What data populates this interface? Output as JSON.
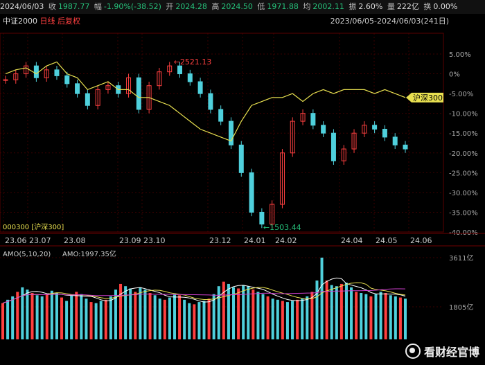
{
  "header": {
    "date": "2024/06/03",
    "close_label": "收",
    "close": "1987.77",
    "chg_label": "幅",
    "chg": "-1.90%(-38.52)",
    "open_label": "开",
    "open": "2024.28",
    "high_label": "高",
    "high": "2024.50",
    "low_label": "低",
    "low": "1971.88",
    "avg_label": "均",
    "avg": "2002.11",
    "amp_label": "振",
    "amp": "2.60%",
    "amount_label": "量",
    "amount": "222亿",
    "turnover_label": "换",
    "turnover": "0.00%"
  },
  "subheader": {
    "index_name": "中证2000",
    "period": "日线",
    "adjust": "后复权",
    "range": "2023/06/05-2024/06/03(241日)"
  },
  "chart_data": [
    {
      "type": "line",
      "title": "中证2000",
      "x": [
        "23.06",
        "23.07",
        "23.08",
        "23.09",
        "23.10",
        "23.12",
        "24.01",
        "24.02",
        "24.04",
        "24.05",
        "24.06"
      ],
      "ylim": [
        -40,
        5
      ],
      "y_ticks": [
        "5.00%",
        "0%",
        "-5.00%",
        "-10.00%",
        "-15.00%",
        "-20.00%",
        "-25.00%",
        "-30.00%",
        "-35.00%",
        "-40.00%"
      ],
      "series": [
        {
          "name": "中证2000",
          "style": "candles",
          "values": [
            -1.5,
            0,
            2,
            -1,
            1,
            -0.5,
            -2.5,
            -5,
            -8,
            -4,
            -3,
            -5,
            -1,
            -9,
            -3,
            0.5,
            2,
            0,
            -2,
            -5,
            -9,
            -12,
            -18,
            -25,
            -35,
            -38,
            -33,
            -20,
            -12,
            -10,
            -13,
            -15,
            -22,
            -19,
            -15,
            -13,
            -14,
            -16,
            -18,
            -19
          ],
          "color_up": "#ff4040",
          "color_down": "#4fd0dc"
        },
        {
          "name": "沪深300",
          "values": [
            0,
            1,
            1.5,
            0,
            2,
            3,
            0,
            -1,
            -4,
            -3,
            -2,
            -4,
            -4,
            -6,
            -6,
            -7,
            -8,
            -10,
            -12,
            -14,
            -15,
            -16,
            -17,
            -12,
            -8,
            -7,
            -6,
            -6,
            -5,
            -7,
            -5,
            -4,
            -5,
            -4,
            -4,
            -4,
            -5,
            -4,
            -5,
            -6
          ],
          "color": "#e8e050"
        }
      ],
      "annotations": [
        {
          "text": "2521.13",
          "color": "#ff4040"
        },
        {
          "text": "1503.44",
          "color": "#26c07a"
        },
        {
          "text": "沪深300",
          "color": "#e8e050"
        }
      ],
      "legend": "000300 [沪深300]",
      "colors": {
        "up": "#ff4040",
        "down": "#4fd0dc",
        "compare": "#e8e050",
        "grid": "#3a0000"
      }
    },
    {
      "type": "bar",
      "title": "AMO(5,10,20)",
      "value_label": "AMO:1997.35亿",
      "y_ticks": [
        "3611亿",
        "1805亿"
      ],
      "ylim": [
        0,
        3611
      ],
      "values": [
        1600,
        1750,
        1900,
        2100,
        2300,
        2200,
        2050,
        1950,
        1900,
        2000,
        2150,
        2050,
        1850,
        1700,
        1950,
        2100,
        2000,
        1800,
        1650,
        1600,
        1700,
        1750,
        1900,
        2200,
        2450,
        2350,
        2250,
        2100,
        2300,
        2200,
        2050,
        1950,
        1800,
        1750,
        1850,
        2000,
        1950,
        1750,
        1600,
        1550,
        1650,
        1700,
        1800,
        2000,
        2350,
        2550,
        2450,
        2300,
        2250,
        2400,
        2350,
        2200,
        2100,
        2000,
        1900,
        1800,
        1750,
        1700,
        1650,
        1700,
        1750,
        1800,
        1900,
        2100,
        2600,
        3611,
        2600,
        2400,
        2350,
        2450,
        2500,
        2300,
        2100,
        2050,
        2000,
        1900,
        2000,
        2100,
        2050,
        1950,
        1900,
        1850,
        1800
      ],
      "ma_colors": [
        "#ffffff",
        "#e8e050",
        "#d040d0"
      ]
    }
  ],
  "watermark": "看财经官博"
}
